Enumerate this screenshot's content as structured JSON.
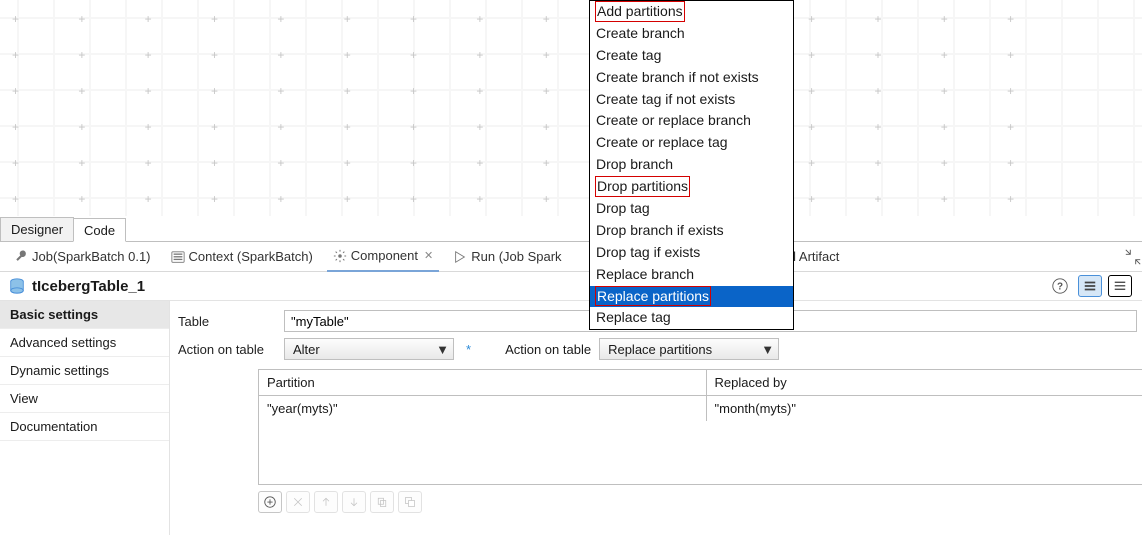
{
  "editor_tabs": {
    "designer": "Designer",
    "code": "Code",
    "active": "Designer"
  },
  "subtabs": {
    "job": "Job(SparkBatch 0.1)",
    "context": "Context (SparkBatch)",
    "component": "Component",
    "run_label": "Run (Job Spark",
    "artifact_suffix": "ud Artifact"
  },
  "component_title": "tIcebergTable_1",
  "left_nav": {
    "items": [
      "Basic settings",
      "Advanced settings",
      "Dynamic settings",
      "View",
      "Documentation"
    ],
    "active_index": 0
  },
  "form": {
    "table_label": "Table",
    "table_value": "\"myTable\"",
    "action1_label": "Action on table",
    "action1_value": "Alter",
    "action2_label": "Action on table",
    "action2_value": "Replace partitions",
    "partitions": {
      "col1_header": "Partition",
      "col2_header": "Replaced by",
      "rows": [
        {
          "partition": "\"year(myts)\"",
          "replaced_by": "\"month(myts)\""
        }
      ]
    }
  },
  "dropdown": {
    "options": [
      "Add partitions",
      "Create branch",
      "Create tag",
      "Create branch if not exists",
      "Create tag if not exists",
      "Create or replace branch",
      "Create or replace tag",
      "Drop branch",
      "Drop partitions",
      "Drop tag",
      "Drop branch if exists",
      "Drop tag if exists",
      "Replace branch",
      "Replace partitions",
      "Replace tag"
    ],
    "highlighted_indices": [
      0,
      8,
      13
    ],
    "selected_index": 13
  },
  "toolbar_icons": [
    "add",
    "remove",
    "up",
    "down",
    "copy",
    "paste"
  ]
}
